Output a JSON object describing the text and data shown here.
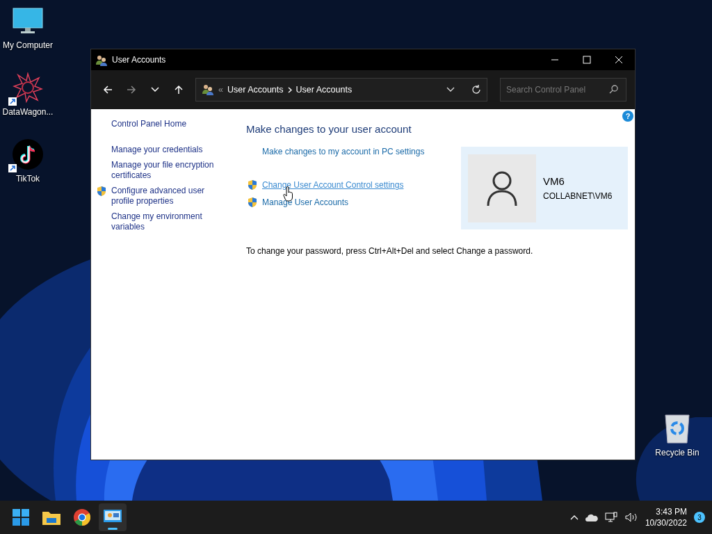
{
  "desktop_icons": [
    {
      "kind": "computer",
      "label": "My Computer",
      "shortcut": false
    },
    {
      "kind": "mandala",
      "label": "DataWagon...",
      "shortcut": true
    },
    {
      "kind": "tiktok",
      "label": "TikTok",
      "shortcut": true
    },
    {
      "kind": "recycle",
      "label": "Recycle Bin",
      "shortcut": false
    }
  ],
  "window": {
    "title": "User Accounts",
    "address": {
      "overflow": "«",
      "crumbs": [
        "User Accounts",
        "User Accounts"
      ]
    },
    "search": {
      "placeholder": "Search Control Panel"
    },
    "help": "?",
    "sidebar": [
      {
        "label": "Control Panel Home",
        "shield": false
      },
      {
        "label": "Manage your credentials",
        "shield": false
      },
      {
        "label": "Manage your file encryption certificates",
        "shield": false
      },
      {
        "label": "Configure advanced user profile properties",
        "shield": true
      },
      {
        "label": "Change my environment variables",
        "shield": false
      }
    ],
    "heading": "Make changes to your user account",
    "links": [
      {
        "label": "Make changes to my account in PC settings",
        "shield": false,
        "hovered": false
      },
      {
        "label": "Change User Account Control settings",
        "shield": true,
        "hovered": true
      },
      {
        "label": "Manage User Accounts",
        "shield": true,
        "hovered": false
      }
    ],
    "account": {
      "name": "VM6",
      "domain": "COLLABNET\\VM6"
    },
    "note": "To change your password, press Ctrl+Alt+Del and select Change a password."
  },
  "taskbar": {
    "apps": [
      {
        "kind": "start",
        "selected": false
      },
      {
        "kind": "explorer",
        "selected": false
      },
      {
        "kind": "chrome",
        "selected": false
      },
      {
        "kind": "control",
        "selected": true
      }
    ],
    "time": "3:43 PM",
    "date": "10/30/2022",
    "notifications": "3"
  }
}
